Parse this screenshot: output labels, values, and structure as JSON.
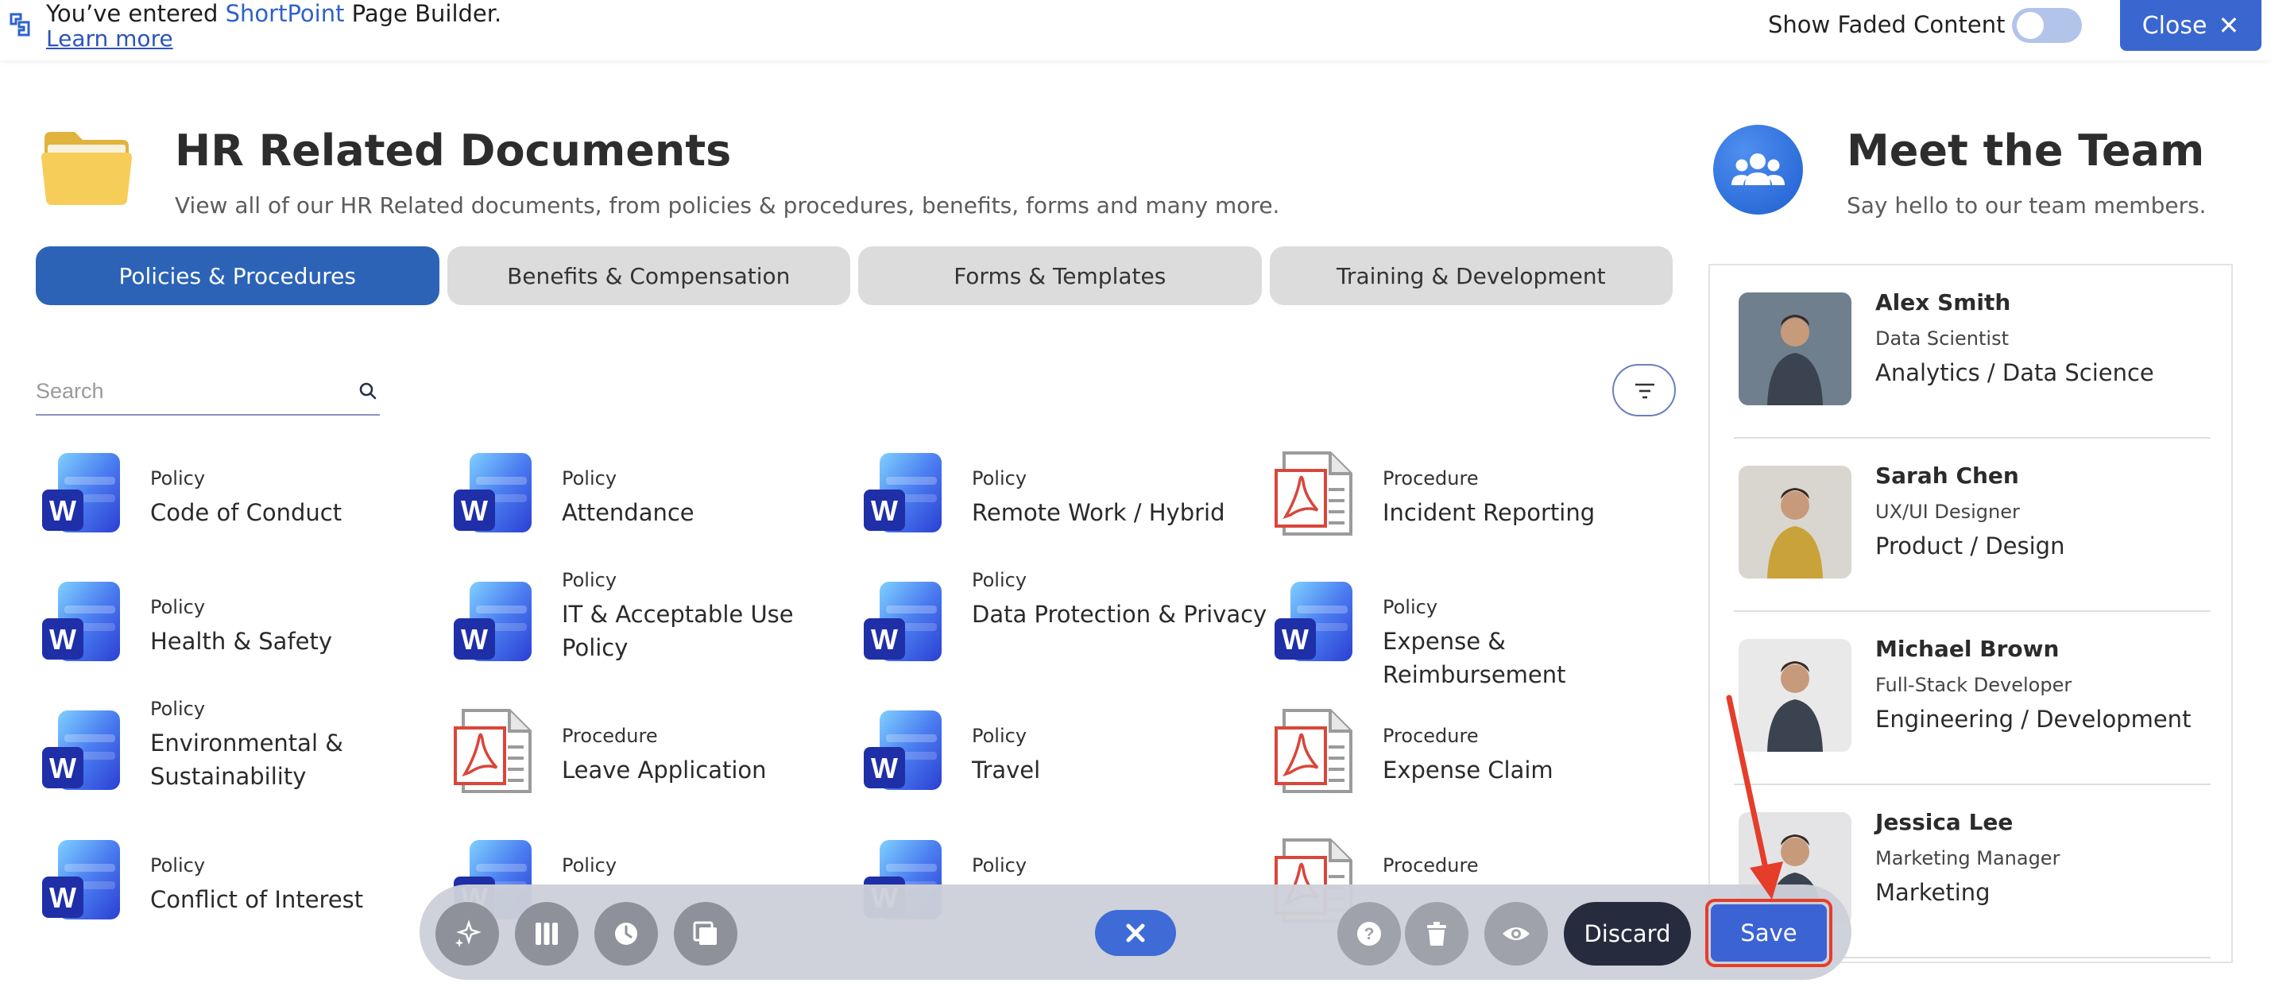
{
  "banner": {
    "prefix": "You’ve entered ",
    "brand": "ShortPoint",
    "suffix": " Page Builder.",
    "learn_more": "Learn more",
    "show_faded_label": "Show Faded Content",
    "show_faded_on": false,
    "close_label": "Close"
  },
  "hr": {
    "title": "HR Related Documents",
    "subtitle": "View all of our HR Related documents, from policies & procedures, benefits, forms and many more.",
    "tabs": [
      {
        "label": "Policies & Procedures",
        "active": true
      },
      {
        "label": "Benefits & Compensation",
        "active": false
      },
      {
        "label": "Forms & Templates",
        "active": false
      },
      {
        "label": "Training & Development",
        "active": false
      }
    ],
    "search_placeholder": "Search",
    "documents": [
      {
        "type": "Policy",
        "name": "Code of Conduct",
        "icon": "word-icon"
      },
      {
        "type": "Policy",
        "name": "Attendance",
        "icon": "word-icon"
      },
      {
        "type": "Policy",
        "name": "Remote Work / Hybrid",
        "icon": "word-icon"
      },
      {
        "type": "Procedure",
        "name": "Incident Reporting",
        "icon": "pdf-icon"
      },
      {
        "type": "Policy",
        "name": "Health & Safety",
        "icon": "word-icon"
      },
      {
        "type": "Policy",
        "name": "IT & Acceptable Use Policy",
        "icon": "word-icon"
      },
      {
        "type": "Policy",
        "name": "Data Protection & Privacy",
        "icon": "word-icon"
      },
      {
        "type": "Policy",
        "name": "Expense & Reimbursement",
        "icon": "word-icon"
      },
      {
        "type": "Policy",
        "name": "Environmental & Sustainability",
        "icon": "word-icon"
      },
      {
        "type": "Procedure",
        "name": "Leave Application",
        "icon": "pdf-icon"
      },
      {
        "type": "Policy",
        "name": "Travel",
        "icon": "word-icon"
      },
      {
        "type": "Procedure",
        "name": "Expense Claim",
        "icon": "pdf-icon"
      },
      {
        "type": "Policy",
        "name": "Conflict of Interest",
        "icon": "word-icon"
      },
      {
        "type": "Policy",
        "name": "",
        "icon": "word-icon"
      },
      {
        "type": "Policy",
        "name": "",
        "icon": "word-icon"
      },
      {
        "type": "Procedure",
        "name": "",
        "icon": "pdf-icon"
      }
    ]
  },
  "team": {
    "title": "Meet the Team",
    "subtitle": "Say hello to our team members.",
    "members": [
      {
        "name": "Alex Smith",
        "role": "Data Scientist",
        "dept": "Analytics / Data Science",
        "photo_bg": "#6f7f8e"
      },
      {
        "name": "Sarah Chen",
        "role": "UX/UI Designer",
        "dept": "Product / Design",
        "photo_bg": "#d9d6cf"
      },
      {
        "name": "Michael Brown",
        "role": "Full-Stack Developer",
        "dept": "Engineering / Development",
        "photo_bg": "#e9e9ea"
      },
      {
        "name": "Jessica Lee",
        "role": "Marketing Manager",
        "dept": "Marketing",
        "photo_bg": "#e4e4e6"
      }
    ]
  },
  "toolbar": {
    "left_buttons": [
      "sparkle-icon",
      "columns-icon",
      "clock-icon",
      "copy-icon"
    ],
    "right_buttons": [
      "help-icon",
      "trash-icon",
      "eye-icon"
    ],
    "discard_label": "Discard",
    "save_label": "Save"
  },
  "colors": {
    "accent": "#3a66cf",
    "tab_active": "#2c63b7",
    "discard_bg": "#262b3e",
    "highlight": "#e53d2a"
  }
}
